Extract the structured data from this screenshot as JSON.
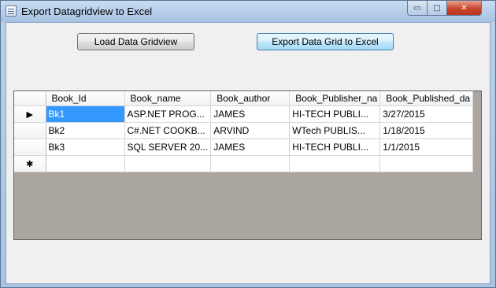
{
  "window": {
    "title": "Export Datagridview to Excel",
    "controls": {
      "minimize": "▭",
      "maximize": "□",
      "close": "✕"
    }
  },
  "buttons": {
    "load": "Load Data Gridview",
    "export": "Export Data Grid to Excel"
  },
  "grid": {
    "columns": [
      "Book_Id",
      "Book_name",
      "Book_author",
      "Book_Publisher_na",
      "Book_Published_da"
    ],
    "rows": [
      {
        "indicator": "▶",
        "cells": [
          "Bk1",
          "ASP.NET PROG...",
          "JAMES",
          "HI-TECH PUBLI...",
          "3/27/2015"
        ]
      },
      {
        "indicator": "",
        "cells": [
          "Bk2",
          "C#.NET COOKB...",
          "ARVIND",
          "WTech PUBLIS...",
          "1/18/2015"
        ]
      },
      {
        "indicator": "",
        "cells": [
          "Bk3",
          "SQL SERVER 20...",
          "JAMES",
          "HI-TECH PUBLI...",
          "1/1/2015"
        ]
      }
    ],
    "new_row_indicator": "✱",
    "selected_cell": "Bk1"
  },
  "colors": {
    "selection": "#3399ff",
    "grid_background": "#aba5a0",
    "close_button": "#c7452b"
  }
}
